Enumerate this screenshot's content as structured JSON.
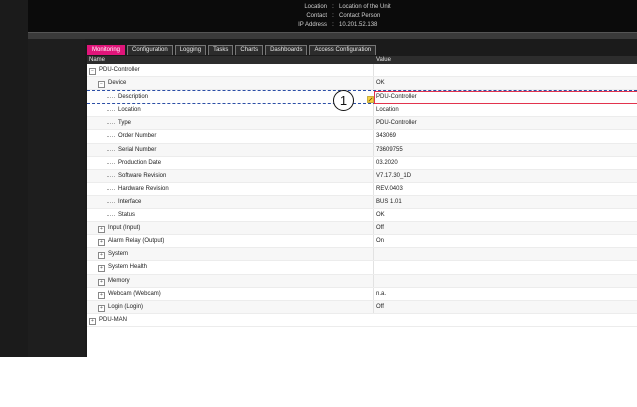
{
  "header": {
    "location_label": "Location",
    "location_value": "Location of the Unit",
    "contact_label": "Contact",
    "contact_value": "Contact Person",
    "ip_label": "IP Address",
    "ip_value": "10.201.52.138",
    "separator": ":"
  },
  "tabs": [
    "Monitoring",
    "Configuration",
    "Logging",
    "Tasks",
    "Charts",
    "Dashboards",
    "Access Configuration"
  ],
  "active_tab": "Monitoring",
  "columns": {
    "name": "Name",
    "value": "Value"
  },
  "tree": {
    "root": "PDU-Controller",
    "device": {
      "label": "Device",
      "value": "OK"
    },
    "device_fields": [
      {
        "label": "Description",
        "value": "PDU-Controller"
      },
      {
        "label": "Location",
        "value": "Location"
      },
      {
        "label": "Type",
        "value": "PDU-Controller"
      },
      {
        "label": "Order Number",
        "value": "343069"
      },
      {
        "label": "Serial Number",
        "value": "73609755"
      },
      {
        "label": "Production Date",
        "value": "03.2020"
      },
      {
        "label": "Software Revision",
        "value": "V7.17.30_1D"
      },
      {
        "label": "Hardware Revision",
        "value": "REV.0403"
      },
      {
        "label": "Interface",
        "value": "BUS 1.01"
      },
      {
        "label": "Status",
        "value": "OK"
      }
    ],
    "groups": [
      {
        "label": "Input (Input)",
        "value": "Off"
      },
      {
        "label": "Alarm Relay (Output)",
        "value": "On"
      },
      {
        "label": "System",
        "value": ""
      },
      {
        "label": "System Health",
        "value": ""
      },
      {
        "label": "Memory",
        "value": ""
      },
      {
        "label": "Webcam (Webcam)",
        "value": "n.a."
      },
      {
        "label": "Login (Login)",
        "value": "Off"
      }
    ],
    "second_root": "PDU-MAN"
  },
  "expand_symbols": {
    "collapsed": "+",
    "expanded": "−"
  },
  "callout": "1",
  "colors": {
    "accent": "#e0157a",
    "highlight_border": "#e2334d",
    "dark_bg": "#1b1b1b"
  }
}
